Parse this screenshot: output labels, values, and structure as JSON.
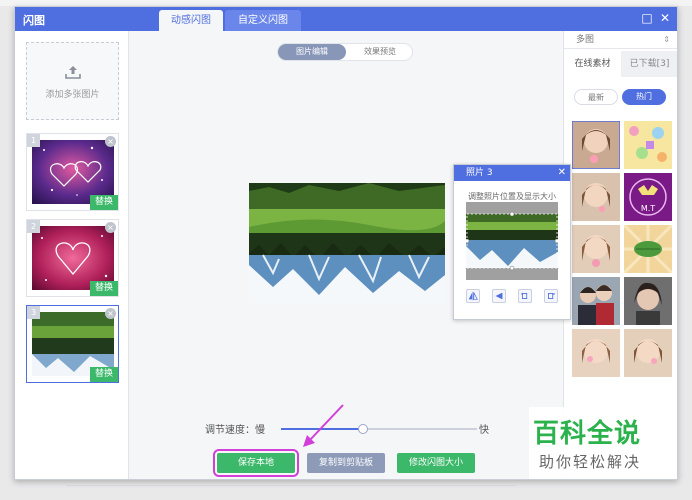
{
  "window": {
    "app_title": "闪图",
    "tabs": [
      "动感闪图",
      "自定义闪图"
    ],
    "controls": {
      "minimize": "□",
      "close": "✕"
    }
  },
  "left_panel": {
    "add_label": "添加多张图片",
    "add_icon": "upload-icon",
    "thumbnails": [
      {
        "number": "1",
        "replace_label": "替换",
        "selected": false,
        "image": "purple-sparkle-love"
      },
      {
        "number": "2",
        "replace_label": "替换",
        "selected": false,
        "image": "red-heart-love"
      },
      {
        "number": "3",
        "replace_label": "替换",
        "selected": true,
        "image": "flipped-landscape"
      }
    ]
  },
  "center": {
    "segments": [
      "图片编辑",
      "效果预览"
    ],
    "active_segment": "图片编辑",
    "speed": {
      "label": "调节速度：慢",
      "fast": "快",
      "value": 0.42
    },
    "buttons": {
      "save": "保存本地",
      "copy": "复制到剪贴板",
      "resize": "修改闪图大小"
    }
  },
  "photo_popup": {
    "title": "照片 3",
    "close": "✕",
    "hint": "调整照片位置及显示大小",
    "tools": [
      "flip-horizontal-icon",
      "flip-vertical-icon",
      "rotate-left-icon",
      "rotate-right-icon"
    ]
  },
  "right_panel": {
    "category": "多图",
    "tabs": [
      "在线素材",
      "已下载[3]"
    ],
    "active_tab": "在线素材",
    "filters": [
      "最新",
      "热门"
    ],
    "active_filter": "热门"
  },
  "watermark": {
    "line1": "百科全说",
    "line2": "助你轻松解决"
  },
  "colors": {
    "accent": "#4f6ee0",
    "green": "#3cb86a",
    "highlight": "#d23fd8",
    "brand": "#2bb24c"
  }
}
